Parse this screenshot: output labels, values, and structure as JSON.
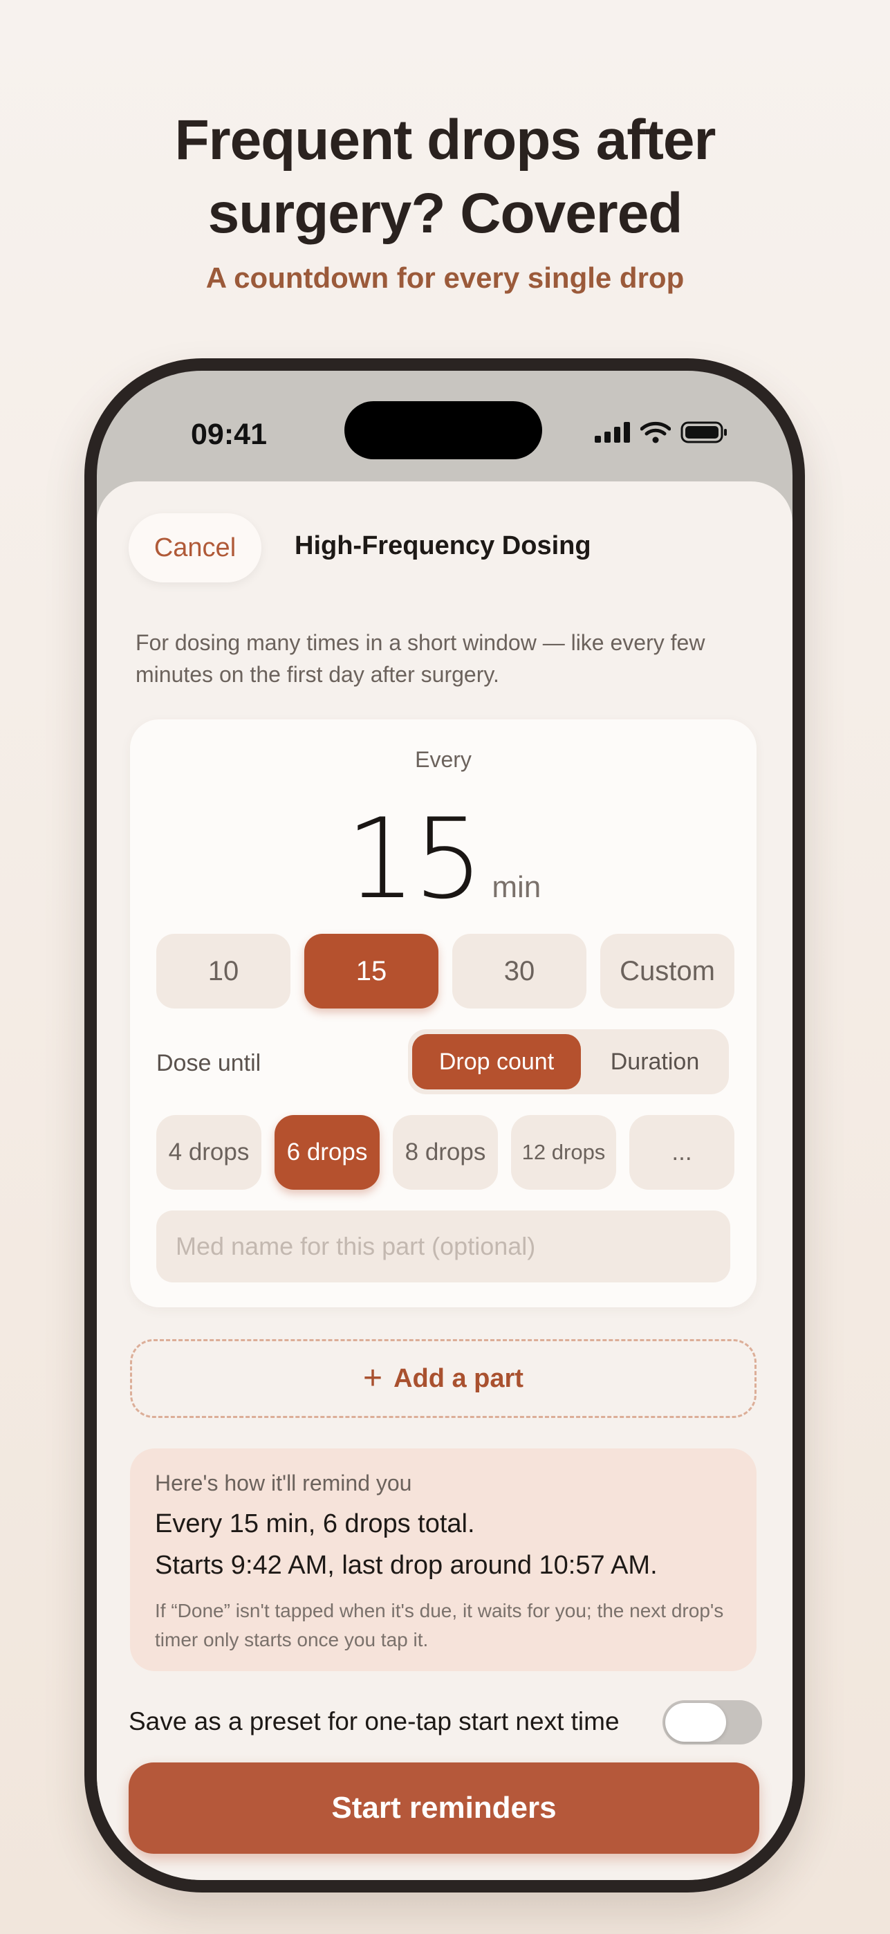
{
  "headline": {
    "line1": "Frequent drops after",
    "line2": "surgery? Covered"
  },
  "subheadline": "A countdown for every single drop",
  "status_bar": {
    "time": "09:41"
  },
  "sheet": {
    "cancel_label": "Cancel",
    "title": "High-Frequency Dosing",
    "description": "For dosing many times in a short window — like every few minutes on the first day after surgery."
  },
  "interval": {
    "label": "Every",
    "value": "15",
    "unit": "min",
    "options": [
      {
        "label": "10",
        "selected": false
      },
      {
        "label": "15",
        "selected": true
      },
      {
        "label": "30",
        "selected": false
      },
      {
        "label": "Custom",
        "selected": false
      }
    ]
  },
  "dose_until": {
    "label": "Dose until",
    "modes": [
      {
        "label": "Drop count",
        "selected": true
      },
      {
        "label": "Duration",
        "selected": false
      }
    ],
    "drop_options": [
      {
        "label": "4 drops",
        "selected": false
      },
      {
        "label": "6 drops",
        "selected": true
      },
      {
        "label": "8 drops",
        "selected": false
      },
      {
        "label": "12 drops",
        "selected": false
      },
      {
        "label": "...",
        "selected": false
      }
    ]
  },
  "med_name": {
    "placeholder": "Med name for this part (optional)",
    "value": ""
  },
  "add_part_label": "Add a part",
  "summary": {
    "intro": "Here's how it'll remind you",
    "line1": "Every 15 min, 6 drops total.",
    "line2": "Starts 9:42 AM, last drop around 10:57 AM.",
    "note": "If “Done” isn't tapped when it's due, it waits for you; the next drop's timer only starts once you tap it."
  },
  "preset": {
    "label": "Save as a preset for one-tap start next time",
    "enabled": false
  },
  "start_button_label": "Start reminders",
  "colors": {
    "accent": "#b5512e",
    "background": "#f6f1ed",
    "summary_bg": "#f6e3da"
  }
}
